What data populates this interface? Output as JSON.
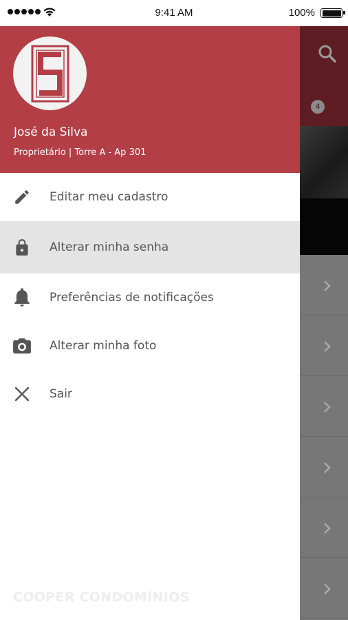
{
  "status_bar": {
    "time": "9:41 AM",
    "battery": "100%"
  },
  "drawer": {
    "user": {
      "name": "José da Silva",
      "subtitle": "Proprietário | Torre A - Ap 301"
    },
    "menu": [
      {
        "label": "Editar meu cadastro",
        "icon": "pencil-icon"
      },
      {
        "label": "Alterar minha senha",
        "icon": "lock-icon",
        "selected": true
      },
      {
        "label": "Preferências de notificações",
        "icon": "bell-icon"
      },
      {
        "label": "Alterar minha foto",
        "icon": "camera-icon"
      },
      {
        "label": "Sair",
        "icon": "close-icon"
      }
    ],
    "brand": "COOPER CONDOMÍNIOS"
  },
  "background": {
    "badge_count": "4"
  },
  "colors": {
    "header": "#b33e46",
    "selected_row": "#e4e4e4",
    "icon": "#555555"
  }
}
